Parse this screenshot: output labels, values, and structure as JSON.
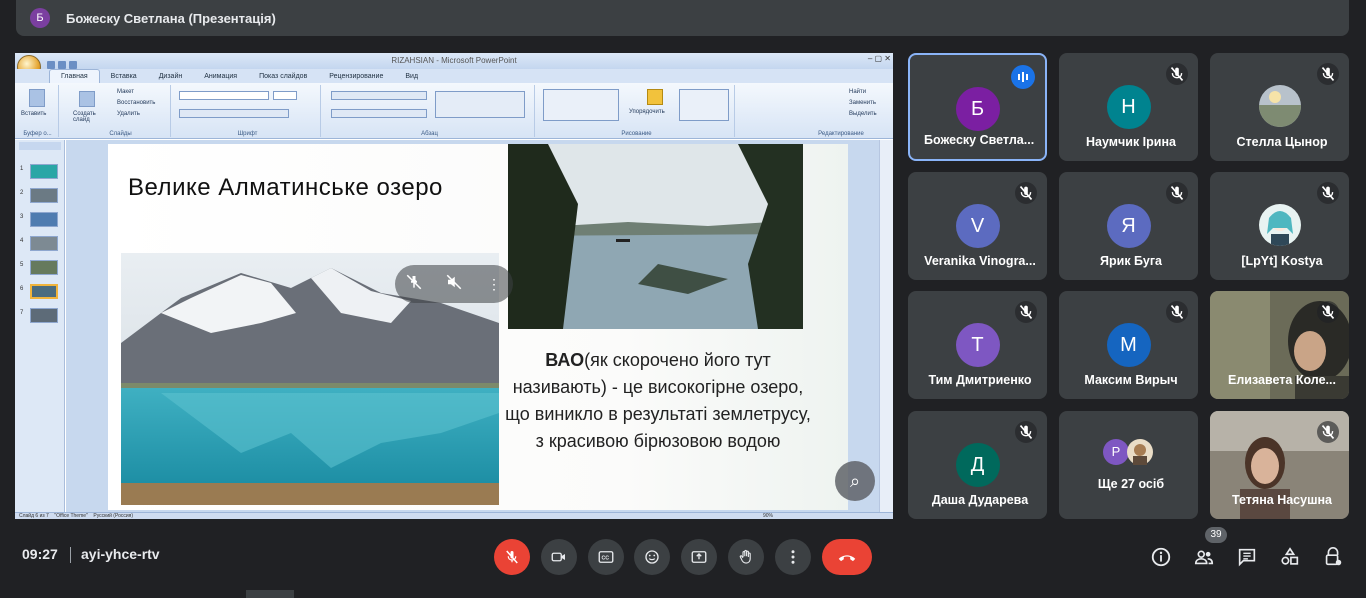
{
  "presenter_bar": {
    "avatar_letter": "Б",
    "title": "Божеску Светлана (Презентація)"
  },
  "powerpoint": {
    "window_title": "RIZAHSIAN - Microsoft PowerPoint",
    "tabs": [
      "Главная",
      "Вставка",
      "Дизайн",
      "Анимация",
      "Показ слайдов",
      "Рецензирование",
      "Вид"
    ],
    "ribbon": {
      "paste": "Вставить",
      "new_slide": "Создать слайд",
      "layout": "Макет",
      "reset": "Восстановить",
      "delete": "Удалить",
      "arrange": "Упорядочить",
      "find": "Найти",
      "replace": "Заменить",
      "select": "Выделить",
      "groups": [
        "Буфер о...",
        "Слайды",
        "Шрифт",
        "Абзац",
        "Рисование",
        "Редактирование"
      ]
    },
    "slide_numbers": [
      "1",
      "2",
      "3",
      "4",
      "5",
      "6",
      "7"
    ],
    "status": {
      "slide": "Слайд 6 из 7",
      "theme": "\"Office Theme\"",
      "lang": "Русский (Россия)",
      "zoom": "90%"
    },
    "slide": {
      "title": "Велике  Алматинське  озеро",
      "text_bold": "ВАО",
      "text_rest": "(як скорочено  його тут називають) - це високогірне озеро, що виникло в результаті землетрусу, з красивою бірюзовою водою"
    }
  },
  "participants": [
    {
      "name": "Божеску Светла...",
      "letter": "Б",
      "color": "#7b1fa2",
      "speaking": true
    },
    {
      "name": "Наумчик Ірина",
      "letter": "Н",
      "color": "#00838f",
      "speaking": false
    },
    {
      "name": "Стелла Цынор",
      "letter": "",
      "color": "#8d9aa5",
      "speaking": false
    },
    {
      "name": "Veranika Vinogra...",
      "letter": "V",
      "color": "#5c6bc0",
      "speaking": false
    },
    {
      "name": "Ярик Буга",
      "letter": "Я",
      "color": "#5c6bc0",
      "speaking": false
    },
    {
      "name": "[LpYt] Kostya",
      "letter": "",
      "color": "#c9e6e8",
      "speaking": false
    },
    {
      "name": "Тим Дмитриенко",
      "letter": "Т",
      "color": "#7e57c2",
      "speaking": false
    },
    {
      "name": "Максим Вирыч",
      "letter": "М",
      "color": "#1565c0",
      "speaking": false
    },
    {
      "name": "Елизавета Коле...",
      "letter": "",
      "color": "#5a5a4a",
      "speaking": false
    },
    {
      "name": "Даша Дударева",
      "letter": "Д",
      "color": "#00695c",
      "speaking": false
    },
    {
      "name": "Ще 27 осіб",
      "letter": "Р",
      "color": "#7e57c2",
      "speaking": false
    },
    {
      "name": "Тетяна Насушна",
      "letter": "",
      "color": "#8a7f70",
      "speaking": false
    }
  ],
  "bottom_bar": {
    "time": "09:27",
    "meeting_code": "ayi-yhce-rtv",
    "participant_count": "39"
  },
  "colors": {
    "background": "#202124",
    "tile": "#3c4043",
    "danger": "#ea4335",
    "accent": "#8ab4f8"
  }
}
